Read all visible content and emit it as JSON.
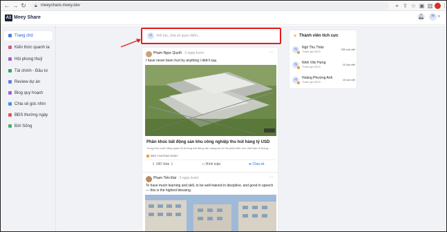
{
  "browser": {
    "url": "meeyshare.meey.dev"
  },
  "app": {
    "logo_mark": "A1",
    "logo_text": "Meey Share",
    "user_initial": "H"
  },
  "sidebar": {
    "items": [
      {
        "label": "Trang chủ",
        "color": "#4f79e8",
        "active": true
      },
      {
        "label": "Kiến thức quanh ta",
        "color": "#d9558a"
      },
      {
        "label": "Hội phong thuỷ",
        "color": "#a25ad6"
      },
      {
        "label": "Tài chính - Đầu tư",
        "color": "#3aa45a"
      },
      {
        "label": "Review dự án",
        "color": "#6c7ae0"
      },
      {
        "label": "Blog quy hoạch",
        "color": "#9a63d9"
      },
      {
        "label": "Chia sẻ góc nhìn",
        "color": "#4f8fe0"
      },
      {
        "label": "BĐS thường ngày",
        "color": "#e05454"
      },
      {
        "label": "Đời Sống",
        "color": "#4ab06a"
      }
    ]
  },
  "composer": {
    "avatar": "H",
    "placeholder": "Viết bài, chia sẻ quan điểm..."
  },
  "posts": [
    {
      "author": "Phạm Ngọc Quyết",
      "time": "· 3 ngày trước",
      "text": "I have never been hurt by anything I didn't say.",
      "title": "Phân khúc bất động sản khu công nghiệp thu hút hàng tỷ USD",
      "subtitle": "Trong bức tranh tổng quan thị trường bất động sản mang lại cơ hội phát triển cho Việt Nam 5 tháng...",
      "tag": "BĐS THƯỜNG NGÀY",
      "votes": "190 Vote",
      "comments": "Bình luận",
      "share": "Chia sẻ"
    },
    {
      "author": "Phạm Tiến Đạt",
      "time": "· 3 ngày trước",
      "text": "To have much learning and skill, to be well-trained in discipline, and good in speech — this is the highest blessing."
    }
  ],
  "members": {
    "title": "Thành viên tích cực",
    "list": [
      {
        "initial": "N",
        "name": "Ngô Thu Thảo",
        "joined": "Tham gia 2023",
        "count": "250 bài viết"
      },
      {
        "initial": "N",
        "name": "Ninh Văn Hưng",
        "joined": "Tham gia 2023",
        "count": "10 bài viết"
      },
      {
        "initial": "H",
        "name": "Hoàng Phương Anh",
        "joined": "Tham gia 2023",
        "count": "10 bài viết"
      }
    ]
  },
  "colors": {
    "highlight": "#e31b1b",
    "brand_dark": "#1a2436",
    "link": "#1a73e8"
  },
  "icons": {
    "back": "arrow-left-icon",
    "forward": "arrow-right-icon",
    "reload": "reload-icon",
    "lock": "lock-icon",
    "bell": "bell-icon",
    "star": "star-icon"
  }
}
